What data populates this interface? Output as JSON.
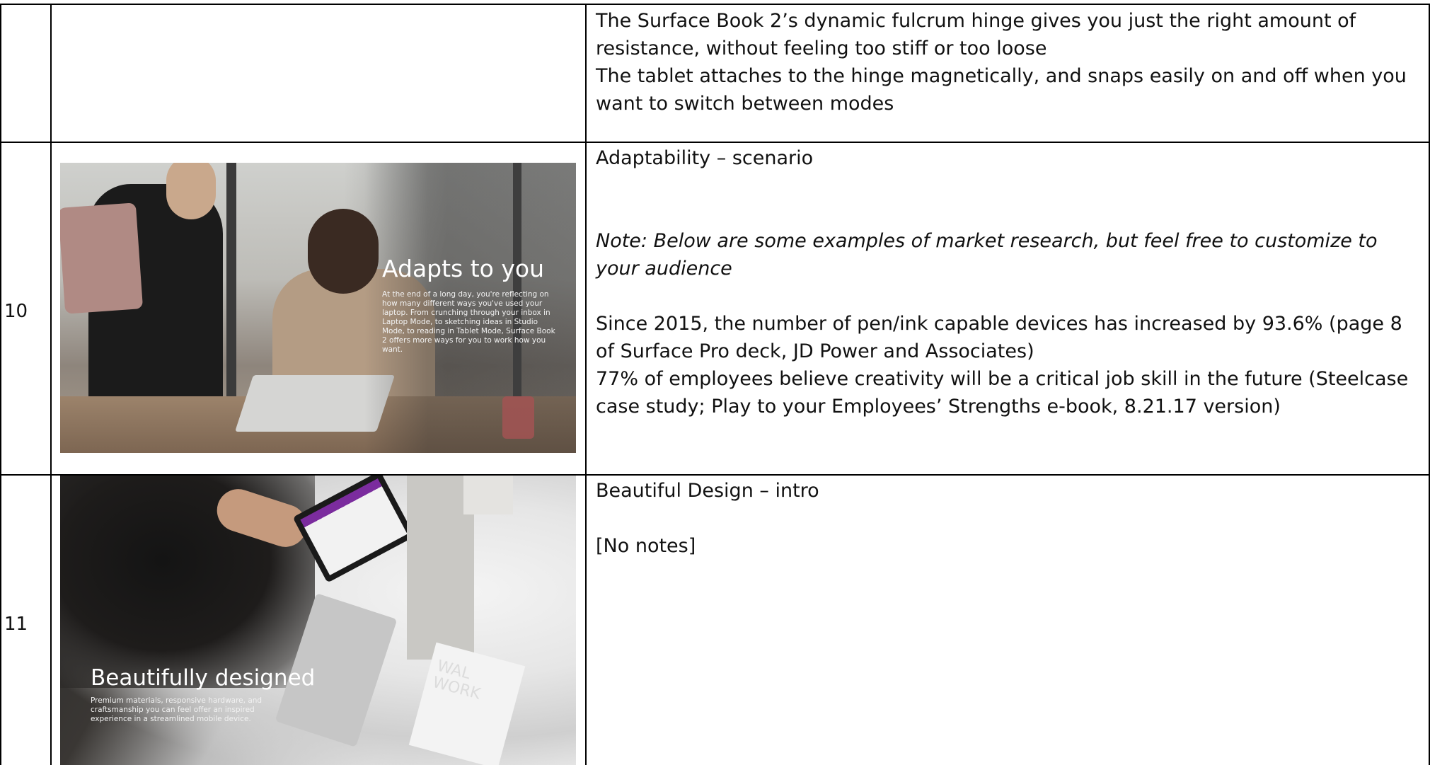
{
  "rows": [
    {
      "number": "",
      "notes": {
        "line1": "The Surface Book 2’s dynamic fulcrum hinge gives you just the right amount of resistance, without feeling too stiff or too loose",
        "line2": "The tablet attaches to the hinge magnetically, and snaps easily on and off when you want to switch between modes"
      }
    },
    {
      "number": "10",
      "slide": {
        "title": "Adapts to you",
        "body": "At the end of a long day, you're reflecting on how many different ways you've used your laptop. From crunching through your inbox in Laptop Mode, to sketching ideas in Studio Mode, to reading in Tablet Mode, Surface Book 2 offers more ways for you to work how you want."
      },
      "notes": {
        "heading": "Adaptability – scenario",
        "note": "Note: Below are some examples of market research, but feel free to customize to your audience",
        "fact1": "Since 2015, the number of pen/ink capable devices has increased by 93.6% (page 8 of Surface Pro deck, JD Power and Associates)",
        "fact2": "77% of employees believe creativity will be a critical job skill in the future (Steelcase case study; Play to your Employees’ Strengths e-book, 8.21.17 version)"
      }
    },
    {
      "number": "11",
      "slide": {
        "title": "Beautifully designed",
        "body": "Premium materials, responsive hardware, and craftsmanship you can feel offer an inspired experience in a streamlined mobile device.",
        "book_cover": "WAL WORK"
      },
      "notes": {
        "heading": "Beautiful Design – intro",
        "note": "[No notes]"
      }
    }
  ],
  "colors": {
    "border": "#000000",
    "text": "#111111",
    "onenote_purple": "#7b2c9e"
  }
}
